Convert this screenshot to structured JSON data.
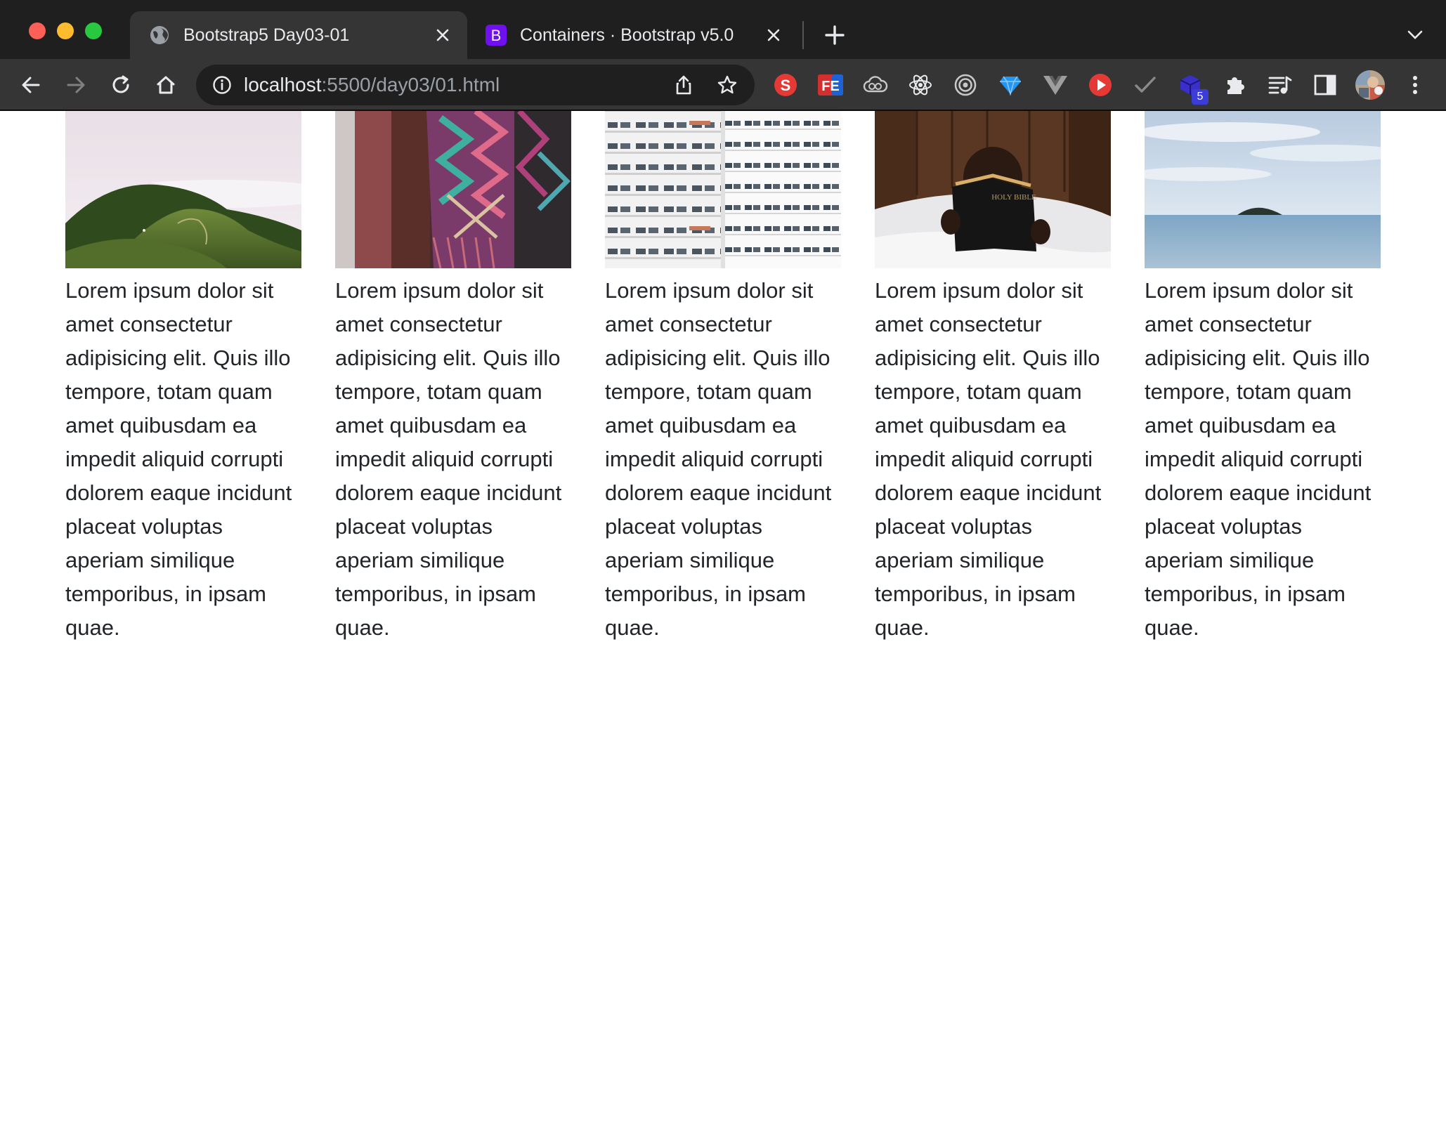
{
  "browser": {
    "tabs": [
      {
        "title": "Bootstrap5 Day03-01",
        "favicon": "globe-icon",
        "active": true
      },
      {
        "title": "Containers · Bootstrap v5.0",
        "favicon": "bootstrap-icon",
        "favicon_letter": "B",
        "active": false
      }
    ],
    "url_host": "localhost",
    "url_path": ":5500/day03/01.html",
    "extensions": [
      {
        "name": "s-extension-icon",
        "letter": "S",
        "color": "#e53935"
      },
      {
        "name": "fe-extension-icon",
        "letter": "FE",
        "color": "#d32f2f"
      },
      {
        "name": "cloud-extension-icon"
      },
      {
        "name": "react-devtools-icon"
      },
      {
        "name": "target-extension-icon"
      },
      {
        "name": "gem-extension-icon"
      },
      {
        "name": "vue-devtools-icon"
      },
      {
        "name": "play-extension-icon"
      },
      {
        "name": "check-extension-icon"
      },
      {
        "name": "cube-extension-icon",
        "badge": "5"
      },
      {
        "name": "puzzle-icon"
      },
      {
        "name": "reading-list-icon"
      },
      {
        "name": "side-panel-icon"
      },
      {
        "name": "profile-avatar"
      },
      {
        "name": "kebab-menu-icon"
      }
    ]
  },
  "cards": [
    {
      "image": "mountain-landscape-image",
      "text": "Lorem ipsum dolor sit amet consectetur adipisicing elit. Quis illo tempore, totam quam amet quibusdam ea impedit aliquid corrupti dolorem eaque incidunt placeat voluptas aperiam similique temporibus, in ipsam quae."
    },
    {
      "image": "woven-blanket-image",
      "text": "Lorem ipsum dolor sit amet consectetur adipisicing elit. Quis illo tempore, totam quam amet quibusdam ea impedit aliquid corrupti dolorem eaque incidunt placeat voluptas aperiam similique temporibus, in ipsam quae."
    },
    {
      "image": "building-facade-image",
      "text": "Lorem ipsum dolor sit amet consectetur adipisicing elit. Quis illo tempore, totam quam amet quibusdam ea impedit aliquid corrupti dolorem eaque incidunt placeat voluptas aperiam similique temporibus, in ipsam quae."
    },
    {
      "image": "reading-bible-image",
      "image_text": "HOLY BIBLE",
      "text": "Lorem ipsum dolor sit amet consectetur adipisicing elit. Quis illo tempore, totam quam amet quibusdam ea impedit aliquid corrupti dolorem eaque incidunt placeat voluptas aperiam similique temporibus, in ipsam quae."
    },
    {
      "image": "calm-sea-island-image",
      "text": "Lorem ipsum dolor sit amet consectetur adipisicing elit. Quis illo tempore, totam quam amet quibusdam ea impedit aliquid corrupti dolorem eaque incidunt placeat voluptas aperiam similique temporibus, in ipsam quae."
    }
  ]
}
